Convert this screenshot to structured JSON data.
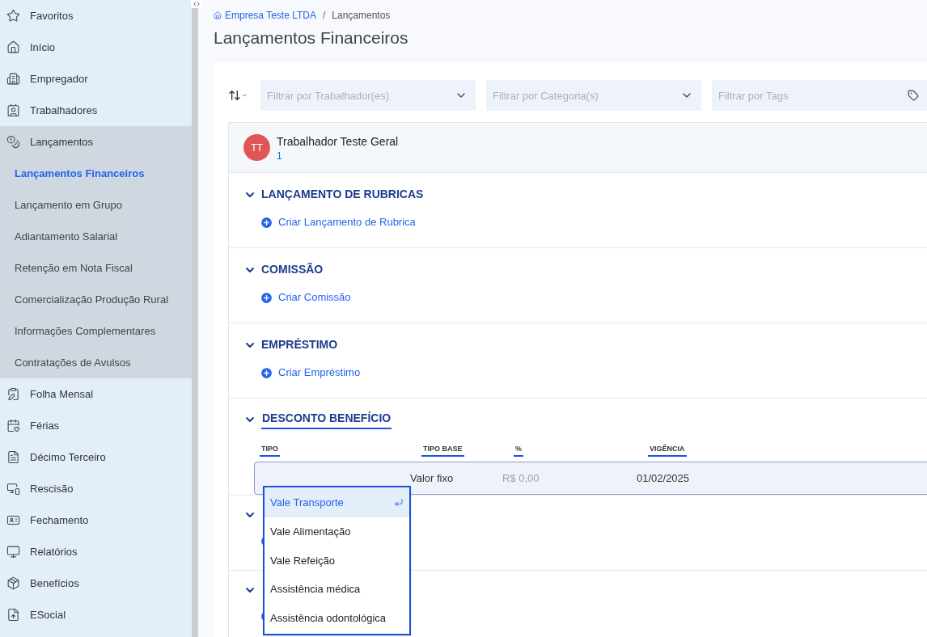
{
  "sidebar": {
    "items": [
      {
        "label": "Favoritos",
        "expanded": false
      },
      {
        "label": "Início",
        "expanded": false
      },
      {
        "label": "Empregador",
        "expanded": false
      },
      {
        "label": "Trabalhadores",
        "expanded": false
      },
      {
        "label": "Lançamentos",
        "expanded": true,
        "children": [
          {
            "label": "Lançamentos Financeiros",
            "selected": true
          },
          {
            "label": "Lançamento em Grupo",
            "selected": false
          },
          {
            "label": "Adiantamento Salarial",
            "selected": false
          },
          {
            "label": "Retenção em Nota Fiscal",
            "selected": false
          },
          {
            "label": "Comercialização Produção Rural",
            "selected": false
          },
          {
            "label": "Informações Complementares",
            "selected": false
          },
          {
            "label": "Contratações de Avulsos",
            "selected": false
          }
        ]
      },
      {
        "label": "Folha Mensal",
        "expanded": false
      },
      {
        "label": "Férias",
        "expanded": false
      },
      {
        "label": "Décimo Terceiro",
        "expanded": false
      },
      {
        "label": "Rescisão",
        "expanded": false
      },
      {
        "label": "Fechamento",
        "expanded": false
      },
      {
        "label": "Relatórios",
        "expanded": false
      },
      {
        "label": "Benefícios",
        "expanded": false
      },
      {
        "label": "ESocial",
        "expanded": false
      }
    ]
  },
  "breadcrumb": [
    "Empresa Teste LTDA",
    "/",
    "Lançamentos"
  ],
  "page_title": "Lançamentos Financeiros",
  "filters": [
    {
      "placeholder": "Filtrar por Trabalhador(es)",
      "kind": "select"
    },
    {
      "placeholder": "Filtrar por Categoria(s)",
      "kind": "select"
    },
    {
      "placeholder": "Filtrar por Tags",
      "kind": "tags"
    }
  ],
  "worker": {
    "initials": "TT",
    "name": "Trabalhador Teste Geral",
    "number": "1"
  },
  "sections": [
    {
      "kind": "action",
      "title": "LANÇAMENTO DE RUBRICAS",
      "expanded": true,
      "action": "Criar Lançamento de Rubrica"
    },
    {
      "kind": "action",
      "title": "COMISSÃO",
      "expanded": true,
      "action": "Criar Comissão"
    },
    {
      "kind": "action",
      "title": "EMPRÉSTIMO",
      "expanded": true,
      "action": "Criar Empréstimo"
    },
    {
      "kind": "table",
      "title": "DESCONTO BENEFÍCIO",
      "expanded": true,
      "columns": [
        "TIPO",
        "TIPO BASE",
        "%",
        "VIGÊNCIA"
      ],
      "row": {
        "tipo_base": "Valor fixo",
        "percent_placeholder": "R$ 0,00",
        "vigencia": "01/02/2025"
      },
      "dropdown": [
        {
          "label": "Vale Transporte",
          "selected": true
        },
        {
          "label": "Vale Alimentação",
          "selected": false
        },
        {
          "label": "Vale Refeição",
          "selected": false
        },
        {
          "label": "Assistência médica",
          "selected": false
        },
        {
          "label": "Assistência odontológica",
          "selected": false
        }
      ]
    },
    {
      "kind": "covered",
      "expanded": true
    },
    {
      "kind": "covered",
      "expanded": true
    }
  ]
}
